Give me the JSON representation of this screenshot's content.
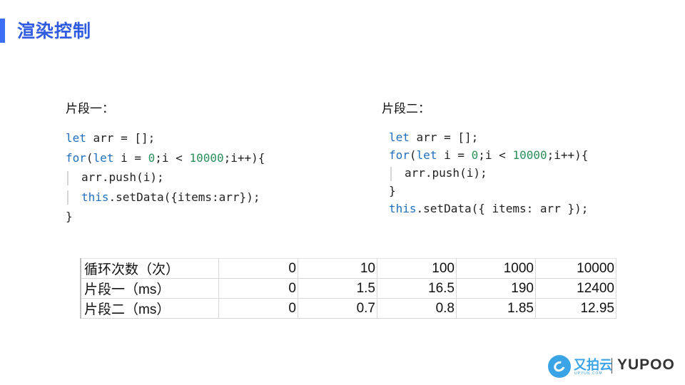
{
  "page": {
    "title": "渲染控制"
  },
  "snippets": [
    {
      "label": "片段一：",
      "lines": [
        {
          "kw1": "let",
          "text": " arr = [];"
        },
        {
          "kw1": "for",
          "mid1": "(",
          "kw2": "let",
          "mid2": " i = ",
          "num1": "0",
          "mid3": ";i < ",
          "num2": "10000",
          "tail": ";i++){"
        },
        {
          "text": "arr.push(i);"
        },
        {
          "kw1": "this",
          "text": ".setData({items:arr});"
        },
        {
          "text": "}"
        }
      ]
    },
    {
      "label": "片段二：",
      "lines": [
        {
          "kw1": "let",
          "text": " arr = [];"
        },
        {
          "kw1": "for",
          "mid1": "(",
          "kw2": "let",
          "mid2": " i = ",
          "num1": "0",
          "mid3": ";i < ",
          "num2": "10000",
          "tail": ";i++){"
        },
        {
          "text": "arr.push(i);"
        },
        {
          "text": "}"
        },
        {
          "kw1": "this",
          "text": ".setData({ items: arr });"
        }
      ]
    }
  ],
  "table": {
    "rows": [
      {
        "label": "循环次数（次）",
        "values": [
          "0",
          "10",
          "100",
          "1000",
          "10000"
        ]
      },
      {
        "label": "片段一（ms）",
        "values": [
          "0",
          "1.5",
          "16.5",
          "190",
          "12400"
        ]
      },
      {
        "label": "片段二（ms）",
        "values": [
          "0",
          "0.7",
          "0.8",
          "1.85",
          "12.95"
        ]
      }
    ]
  },
  "logo": {
    "cn_text": "又拍云",
    "sub_text": "UPYUN.COM",
    "brand": "YUPOO"
  },
  "colors": {
    "accent": "#3b6ff5",
    "title": "#2f5be0",
    "keyword": "#1f6fbf",
    "number": "#2c8f5a",
    "logo_blue": "#3aa4e6"
  }
}
